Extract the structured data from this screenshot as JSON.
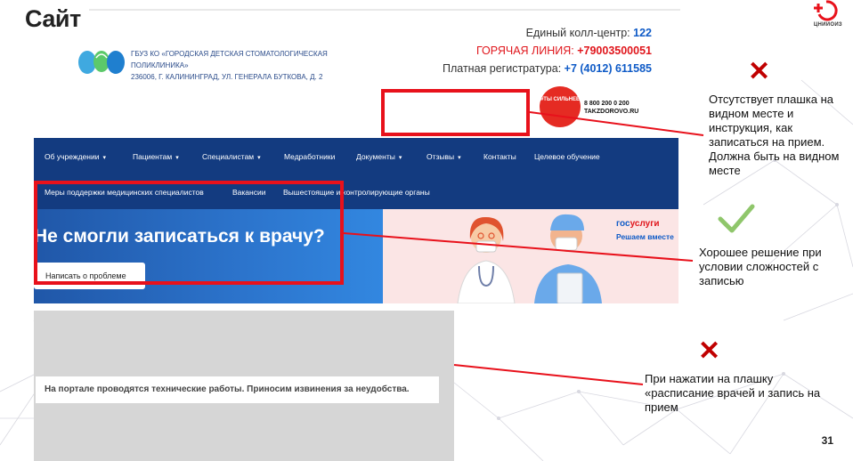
{
  "slide": {
    "title": "Сайт",
    "page_number": "31",
    "brand_caption": "ЦНИИОИЗ"
  },
  "website": {
    "org": {
      "line1": "ГБУЗ КО «ГОРОДСКАЯ ДЕТСКАЯ СТОМАТОЛОГИЧЕСКАЯ",
      "line2": "ПОЛИКЛИНИКА»",
      "line3": "236006, Г. КАЛИНИНГРАД, УЛ. ГЕНЕРАЛА БУТКОВА, Д. 2"
    },
    "contacts": {
      "callcenter_label": "Единый колл-центр: ",
      "callcenter_value": "122",
      "hotline_label": "ГОРЯЧАЯ ЛИНИЯ: ",
      "hotline_value": "+79003500051",
      "paid_label": "Платная регистратура: ",
      "paid_value": "+7 (4012) 611585"
    },
    "badge": {
      "circle_text": "#ТЫ СИЛЬНЕЕ",
      "phone": "8 800 200 0 200",
      "site": "TAKZDOROVO.RU"
    },
    "nav_row1": [
      {
        "label": "Об учреждении",
        "caret": "▾"
      },
      {
        "label": "Пациентам",
        "caret": "▾"
      },
      {
        "label": "Специалистам",
        "caret": "▾"
      },
      {
        "label": "Медработники",
        "caret": ""
      },
      {
        "label": "Документы",
        "caret": "▾"
      },
      {
        "label": "Отзывы",
        "caret": "▾"
      },
      {
        "label": "Контакты",
        "caret": ""
      },
      {
        "label": "Целевое обучение",
        "caret": ""
      }
    ],
    "nav_row2": [
      {
        "label": "Меры поддержки медицинских специалистов"
      },
      {
        "label": "Вакансии"
      },
      {
        "label": "Вышестоящие и контролирующие органы"
      }
    ],
    "hero": {
      "title": "Не смогли записаться к врачу?",
      "button": "Написать о проблеме",
      "gos_part1": "гос",
      "gos_part2": "услуги",
      "gos_tagline": "Решаем вместе"
    },
    "maintenance_notice": "На портале проводятся технические работы. Приносим извинения за неудобства."
  },
  "annotations": [
    {
      "mark": "✕",
      "text": "Отсутствует плашка на видном месте и инструкция, как записаться на прием. Должна быть на видном месте"
    },
    {
      "mark": "✓",
      "text": "Хорошее решение при условии сложностей с записью"
    },
    {
      "mark": "✕",
      "text": "При нажатии на плашку «расписание врачей и запись на прием"
    }
  ],
  "colors": {
    "accent_red": "#e8111b",
    "nav_blue": "#133b80",
    "link_blue": "#0f5bc7",
    "check_green": "#8fc66b",
    "cross_red": "#c00000"
  }
}
